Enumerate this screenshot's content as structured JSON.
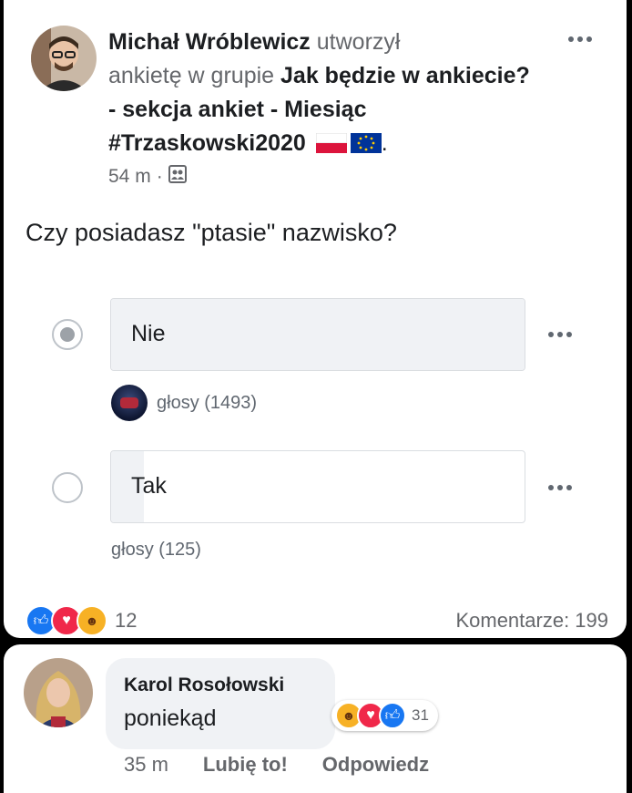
{
  "post": {
    "author": "Michał Wróblewicz",
    "action_1": " utworzył",
    "action_2": "ankietę w grupie ",
    "group": "Jak będzie w ankiecie? - sekcja ankiet - Miesiąc #Trzaskowski2020",
    "time": "54 m",
    "separator": "·",
    "privacy_icon": "group-members-icon",
    "question": "Czy posiadasz \"ptasie\" nazwisko?"
  },
  "poll": {
    "options": [
      {
        "label": "Nie",
        "votes_text": "głosy (1493)",
        "share": 1.0,
        "selected": true
      },
      {
        "label": "Tak",
        "votes_text": "głosy (125)",
        "share": 0.08,
        "selected": false
      }
    ]
  },
  "footer": {
    "reactions_count": "12",
    "comments": "Komentarze: 199"
  },
  "comment": {
    "author": "Karol Rosołowski",
    "text": "poniekąd",
    "reactions_count": "31",
    "time": "35 m",
    "like_label": "Lubię to!",
    "reply_label": "Odpowiedz"
  },
  "colors": {
    "like": "#1877f2",
    "love": "#f0284a",
    "haha": "#f7b125",
    "poll_fill": "#f0f2f5"
  }
}
